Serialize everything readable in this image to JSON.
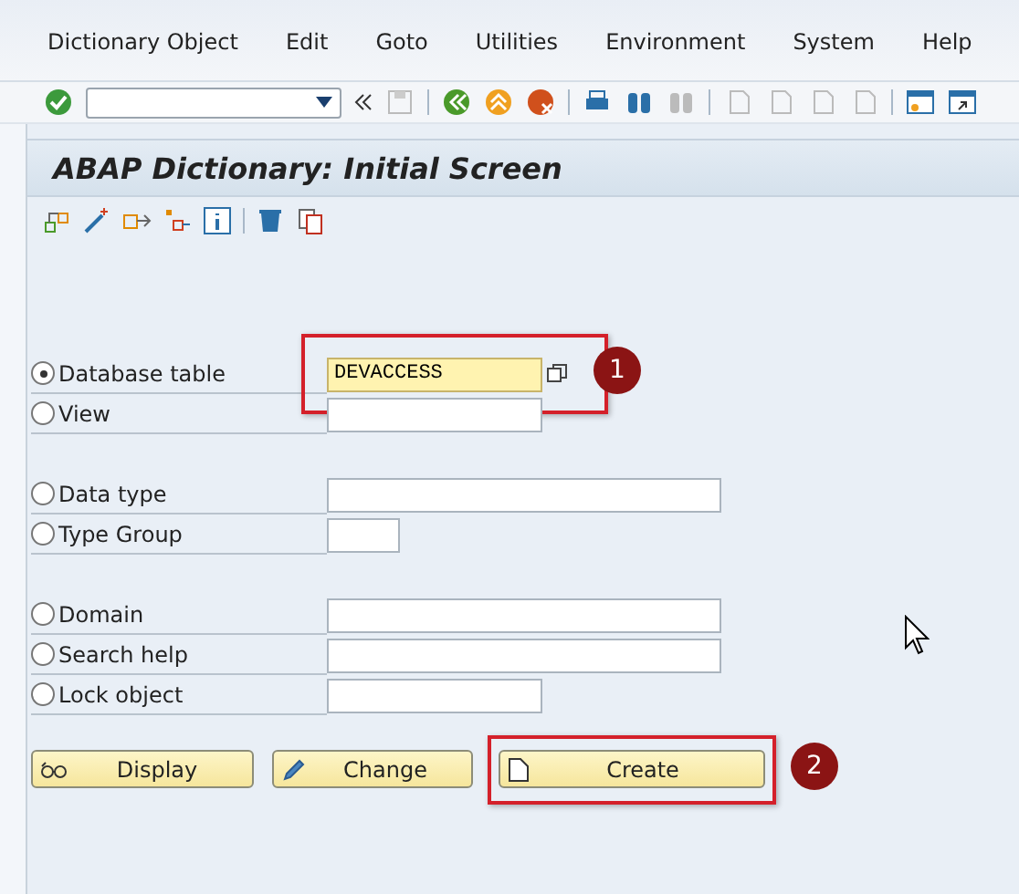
{
  "menu": [
    {
      "label": "Dictionary Object"
    },
    {
      "label": "Edit"
    },
    {
      "label": "Goto"
    },
    {
      "label": "Utilities"
    },
    {
      "label": "Environment"
    },
    {
      "label": "System"
    },
    {
      "label": "Help"
    }
  ],
  "title": "ABAP Dictionary: Initial Screen",
  "groups": [
    [
      {
        "label": "Database table",
        "selected": true,
        "value": "DEVACCESS",
        "focused": true,
        "callout": "1"
      },
      {
        "label": "View",
        "selected": false,
        "focused": false
      }
    ],
    [
      {
        "label": "Data type",
        "selected": false,
        "focused": false
      },
      {
        "label": "Type Group",
        "selected": false,
        "focused": false
      }
    ],
    [
      {
        "label": "Domain",
        "selected": false,
        "focused": false
      },
      {
        "label": "Search help",
        "selected": false,
        "focused": false
      },
      {
        "label": "Lock object",
        "selected": false,
        "focused": false
      }
    ]
  ],
  "buttons": [
    {
      "kind": "display",
      "label": "Display"
    },
    {
      "kind": "change",
      "label": "Change"
    },
    {
      "kind": "create",
      "label": "Create",
      "callout": "2"
    }
  ]
}
